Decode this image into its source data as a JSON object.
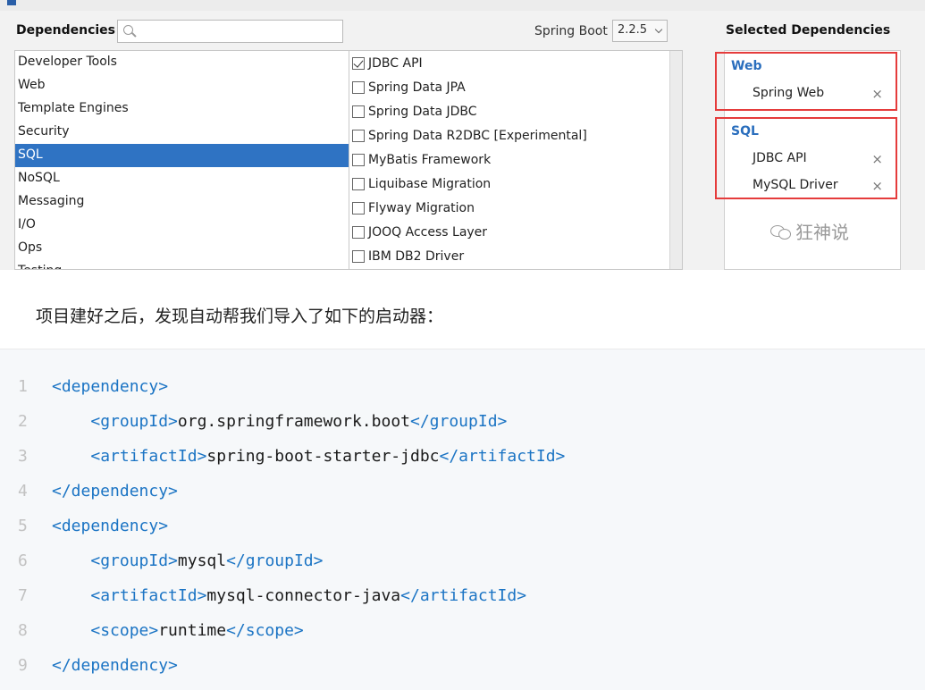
{
  "ide": {
    "dependencies_label": "Dependencies",
    "search_placeholder": "",
    "spring_boot_label": "Spring Boot",
    "spring_boot_version": "2.2.5",
    "selected_dependencies_label": "Selected Dependencies",
    "categories": [
      {
        "label": "Developer Tools",
        "selected": false
      },
      {
        "label": "Web",
        "selected": false
      },
      {
        "label": "Template Engines",
        "selected": false
      },
      {
        "label": "Security",
        "selected": false
      },
      {
        "label": "SQL",
        "selected": true
      },
      {
        "label": "NoSQL",
        "selected": false
      },
      {
        "label": "Messaging",
        "selected": false
      },
      {
        "label": "I/O",
        "selected": false
      },
      {
        "label": "Ops",
        "selected": false
      },
      {
        "label": "Testing",
        "selected": false
      }
    ],
    "dependencies": [
      {
        "label": "JDBC API",
        "checked": true
      },
      {
        "label": "Spring Data JPA",
        "checked": false
      },
      {
        "label": "Spring Data JDBC",
        "checked": false
      },
      {
        "label": "Spring Data R2DBC [Experimental]",
        "checked": false
      },
      {
        "label": "MyBatis Framework",
        "checked": false
      },
      {
        "label": "Liquibase Migration",
        "checked": false
      },
      {
        "label": "Flyway Migration",
        "checked": false
      },
      {
        "label": "JOOQ Access Layer",
        "checked": false
      },
      {
        "label": "IBM DB2 Driver",
        "checked": false
      }
    ],
    "selected_groups": [
      {
        "title": "Web",
        "items": [
          "Spring Web"
        ]
      },
      {
        "title": "SQL",
        "items": [
          "JDBC API",
          "MySQL Driver"
        ]
      }
    ],
    "remove_glyph": "×",
    "watermark": "狂神说",
    "highlight_color": "#e53c3c",
    "accent_color": "#2f73c3"
  },
  "paragraph": "项目建好之后，发现自动帮我们导入了如下的启动器：",
  "code": {
    "lines": [
      {
        "n": "1",
        "indent": "",
        "open": "<dependency>",
        "text": "",
        "close": ""
      },
      {
        "n": "2",
        "indent": "    ",
        "open": "<groupId>",
        "text": "org.springframework.boot",
        "close": "</groupId>"
      },
      {
        "n": "3",
        "indent": "    ",
        "open": "<artifactId>",
        "text": "spring-boot-starter-jdbc",
        "close": "</artifactId>"
      },
      {
        "n": "4",
        "indent": "",
        "open": "</dependency>",
        "text": "",
        "close": ""
      },
      {
        "n": "5",
        "indent": "",
        "open": "<dependency>",
        "text": "",
        "close": ""
      },
      {
        "n": "6",
        "indent": "    ",
        "open": "<groupId>",
        "text": "mysql",
        "close": "</groupId>"
      },
      {
        "n": "7",
        "indent": "    ",
        "open": "<artifactId>",
        "text": "mysql-connector-java",
        "close": "</artifactId>"
      },
      {
        "n": "8",
        "indent": "    ",
        "open": "<scope>",
        "text": "runtime",
        "close": "</scope>"
      },
      {
        "n": "9",
        "indent": "",
        "open": "</dependency>",
        "text": "",
        "close": ""
      }
    ],
    "tag_color": "#1b74c4"
  }
}
